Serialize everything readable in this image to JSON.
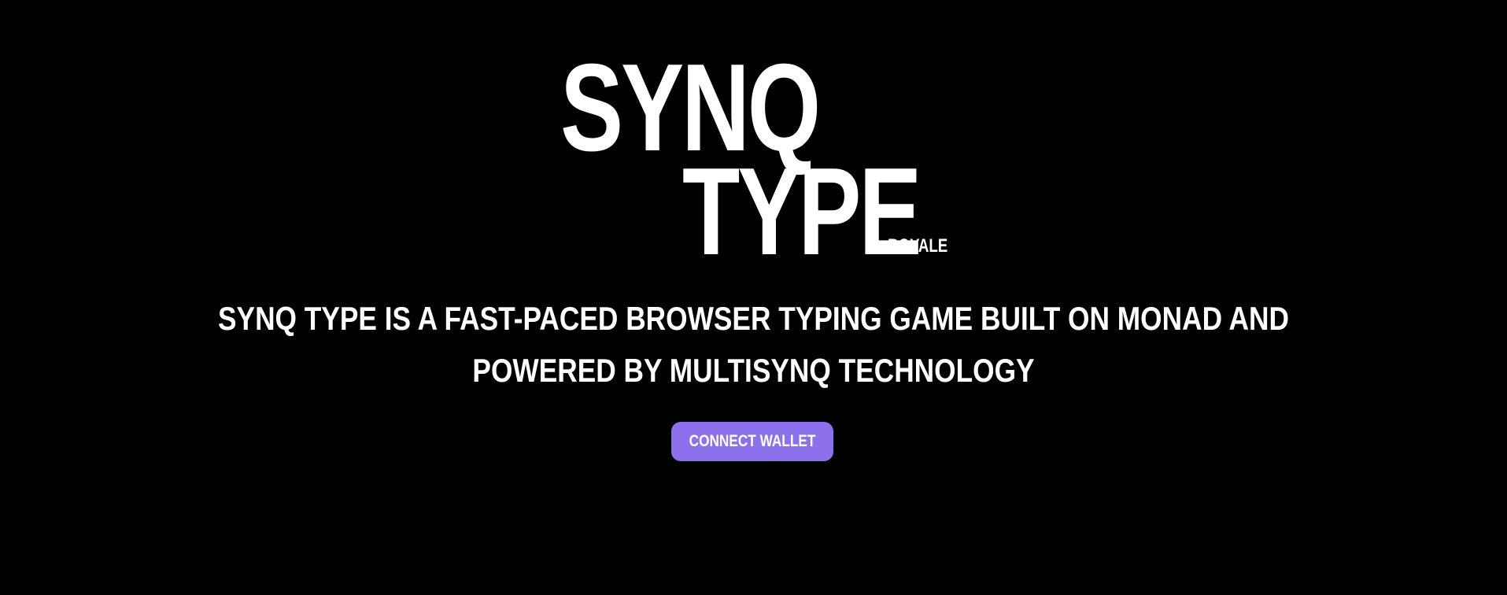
{
  "logo": {
    "line1": "SYNQ",
    "line2": "TYPE",
    "suffix": "ROYALE"
  },
  "tagline": {
    "line1": "SYNQ TYPE IS A FAST-PACED BROWSER TYPING GAME BUILT ON MONAD AND",
    "line2": "POWERED BY MULTISYNQ TECHNOLOGY"
  },
  "actions": {
    "connect_wallet_label": "CONNECT WALLET"
  },
  "colors": {
    "background": "#000000",
    "text": "#ffffff",
    "accent": "#8c70ec"
  }
}
